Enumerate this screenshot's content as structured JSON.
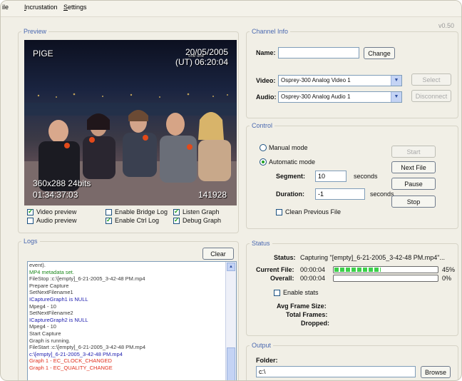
{
  "menu": {
    "file": "ile",
    "incrustation": "Incrustation",
    "settings": "Settings"
  },
  "version": "v0.50",
  "preview": {
    "legend": "Preview",
    "overlay_top_left": "PIGE",
    "overlay_date": "20/05/2005",
    "overlay_time": "(UT) 06:20:04",
    "overlay_logo": "one one",
    "overlay_format": "360x288 24bits",
    "overlay_timecode": "01:34:37:03",
    "overlay_frame": "141928",
    "checkboxes": [
      {
        "label": "Video preview",
        "checked": true
      },
      {
        "label": "Audio preview",
        "checked": false
      },
      {
        "label": "Enable Bridge Log",
        "checked": false
      },
      {
        "label": "Enable Ctrl Log",
        "checked": true
      },
      {
        "label": "Listen Graph",
        "checked": true
      },
      {
        "label": "Debug Graph",
        "checked": true
      }
    ]
  },
  "channel": {
    "legend": "Channel Info",
    "name_label": "Name:",
    "name_value": "",
    "change_label": "Change",
    "video_label": "Video:",
    "video_value": "Osprey-300 Analog Video 1",
    "audio_label": "Audio:",
    "audio_value": "Osprey-300 Analog Audio 1",
    "select_label": "Select",
    "disconnect_label": "Disconnect"
  },
  "control": {
    "legend": "Control",
    "manual_label": "Manual mode",
    "automatic_label": "Automatic mode",
    "mode": "automatic",
    "segment_label": "Segment:",
    "segment_value": "10",
    "segment_unit": "seconds",
    "duration_label": "Duration:",
    "duration_value": "-1",
    "duration_unit": "seconds",
    "clean_label": "Clean Previous File",
    "clean_checked": false,
    "start_label": "Start",
    "next_label": "Next File",
    "pause_label": "Pause",
    "stop_label": "Stop"
  },
  "logs": {
    "legend": "Logs",
    "clear_label": "Clear",
    "colors": {
      "black": "#3a3a3a",
      "green": "#1d8a1d",
      "blue": "#2222b0",
      "red": "#e0301e"
    },
    "lines": [
      {
        "text": "event).",
        "color": "black"
      },
      {
        "text": "MP4 metadata set.",
        "color": "green"
      },
      {
        "text": "FileStop :c:\\[empty]_6-21-2005_3-42-48 PM.mp4",
        "color": "black"
      },
      {
        "text": "Prepare Capture",
        "color": "black"
      },
      {
        "text": "SetNextFilename1",
        "color": "black"
      },
      {
        "text": "ICaptureGraph1 is NULL",
        "color": "blue"
      },
      {
        "text": "Mpeg4 - 10",
        "color": "black"
      },
      {
        "text": "SetNextFilename2",
        "color": "black"
      },
      {
        "text": "ICaptureGraph2 is NULL",
        "color": "blue"
      },
      {
        "text": "Mpeg4 - 10",
        "color": "black"
      },
      {
        "text": "Start Capture",
        "color": "black"
      },
      {
        "text": "Graph is running.",
        "color": "black"
      },
      {
        "text": "FileStart :c:\\[empty]_6-21-2005_3-42-48 PM.mp4",
        "color": "black"
      },
      {
        "text": "c:\\[empty]_6-21-2005_3-42-48 PM.mp4",
        "color": "blue"
      },
      {
        "text": "Graph 1 - EC_CLOCK_CHANGED",
        "color": "red"
      },
      {
        "text": "Graph 1 - EC_QUALITY_CHANGE",
        "color": "red"
      }
    ]
  },
  "status": {
    "legend": "Status",
    "status_label": "Status:",
    "status_value": "Capturing \"[empty]_6-21-2005_3-42-48 PM.mp4\"...",
    "current_label": "Current File:",
    "current_time": "00:00:04",
    "current_progress": 0.45,
    "current_percent": "45%",
    "overall_label": "Overall:",
    "overall_time": "00:00:04",
    "overall_progress": 0.0,
    "overall_percent": "0%",
    "enable_stats_label": "Enable stats",
    "enable_stats_checked": false,
    "avg_label": "Avg Frame Size:",
    "total_label": "Total Frames:",
    "dropped_label": "Dropped:"
  },
  "output": {
    "legend": "Output",
    "folder_label": "Folder:",
    "folder_value": "c:\\",
    "browse_label": "Browse"
  }
}
